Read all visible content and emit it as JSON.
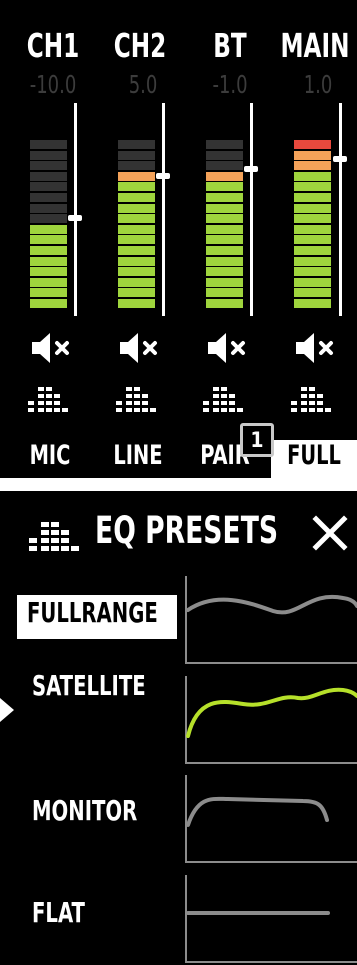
{
  "mixer": {
    "channels": [
      {
        "name": "CH1",
        "level": "-10.0",
        "mode": "MIC"
      },
      {
        "name": "CH2",
        "level": "5.0",
        "mode": "LINE"
      },
      {
        "name": "BT",
        "level": "-1.0",
        "mode": "PAIR"
      },
      {
        "name": "MAIN",
        "level": "1.0",
        "mode": "FULL"
      }
    ],
    "badge": "1",
    "icons": {
      "mute": "speaker-mute-icon",
      "eq": "eq-bars-icon"
    },
    "colors": {
      "green": "#9fd53d",
      "orange": "#f4a259",
      "red": "#e8493d",
      "dark": "#333333"
    }
  },
  "eq": {
    "title": "EQ PRESETS",
    "presets": [
      {
        "label": "FULLRANGE",
        "selected": true
      },
      {
        "label": "SATELLITE",
        "active": true
      },
      {
        "label": "MONITOR"
      },
      {
        "label": "FLAT"
      }
    ],
    "icons": {
      "header": "eq-bars-icon",
      "close": "close-icon"
    },
    "colors": {
      "curve": "#8c8c8c",
      "active_curve": "#b6e02a"
    }
  }
}
